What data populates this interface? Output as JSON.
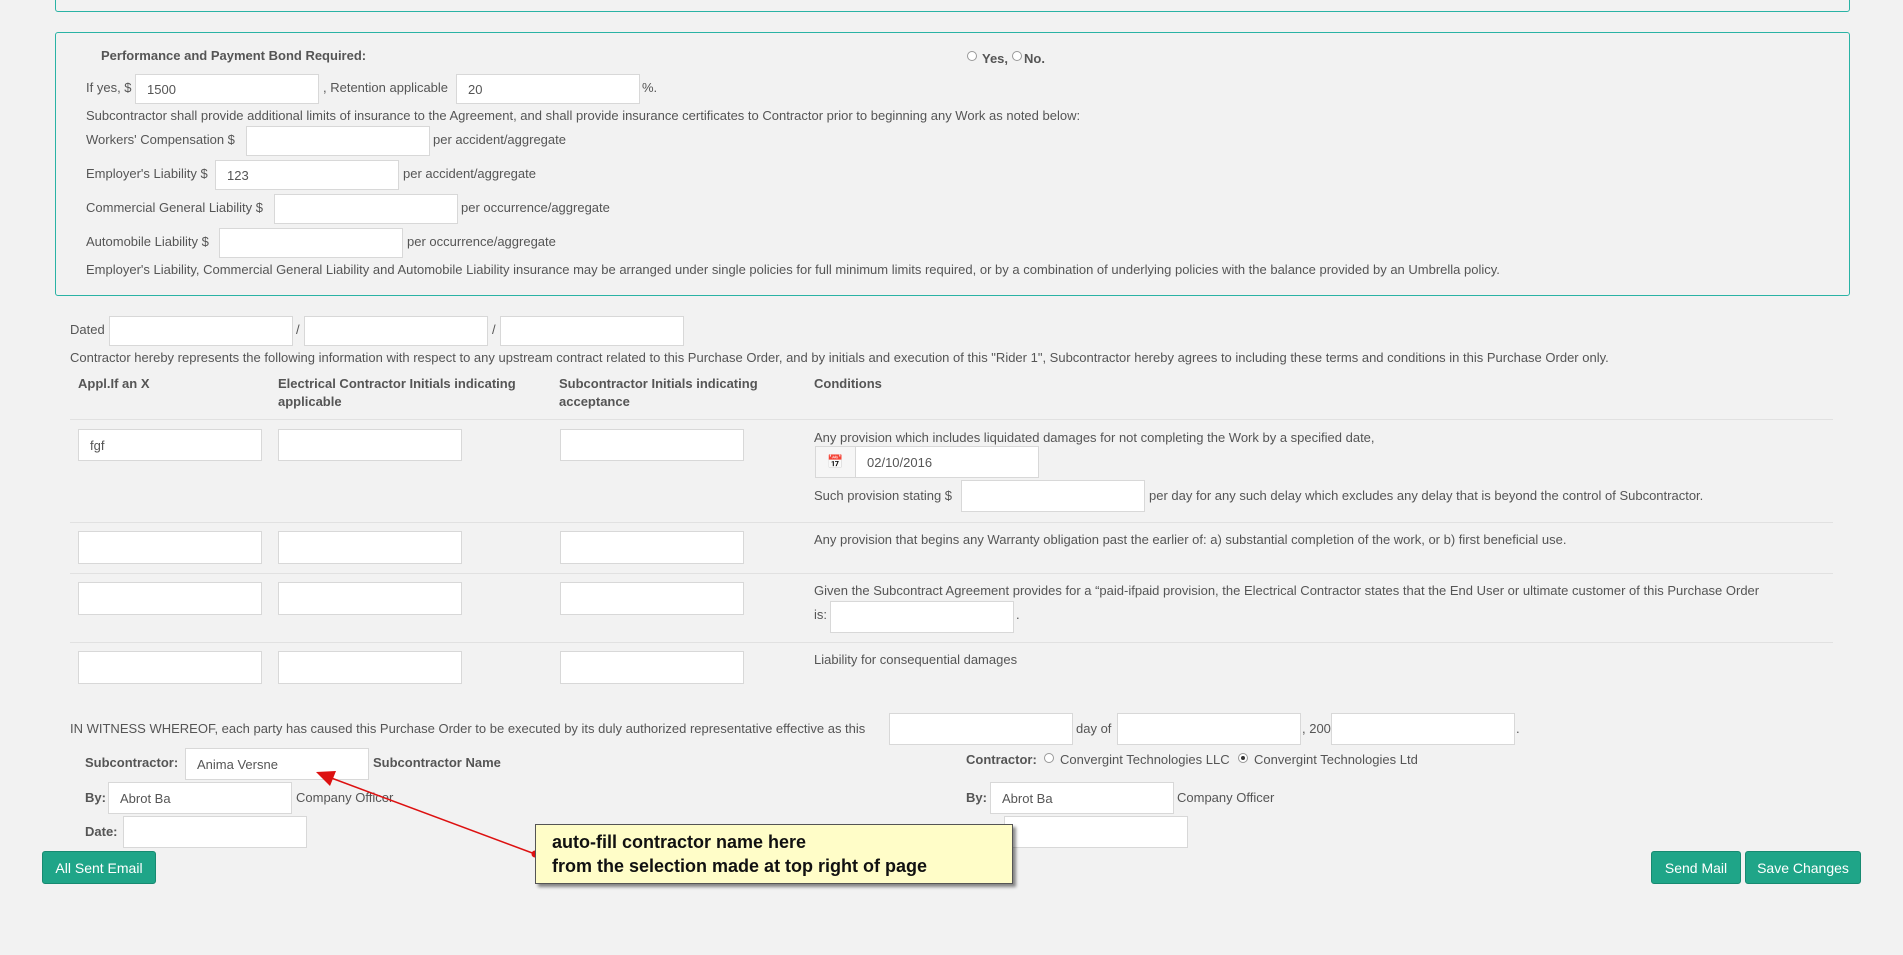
{
  "bond": {
    "heading": "Performance and Payment Bond Required:",
    "yes_label": "Yes,",
    "no_label": "No.",
    "if_yes_label": "If yes, $",
    "bond_amount": "1500",
    "retention_label": ", Retention applicable",
    "retention_value": "20",
    "percent_label": "%.",
    "insurance_intro": "Subcontractor shall provide additional limits of insurance to the Agreement, and shall provide insurance certificates to Contractor prior to beginning any Work as noted below:",
    "workers_comp_label": "Workers' Compensation $",
    "workers_comp_value": "",
    "workers_comp_suffix": "per accident/aggregate",
    "employers_label": "Employer's Liability $",
    "employers_value": "123",
    "employers_suffix": "per accident/aggregate",
    "cgl_label": "Commercial General Liability $",
    "cgl_value": "",
    "cgl_suffix": "per occurrence/aggregate",
    "auto_label": "Automobile Liability $",
    "auto_value": "",
    "auto_suffix": "per occurrence/aggregate",
    "umbrella_note": "Employer's Liability, Commercial General Liability and Automobile Liability insurance may be arranged under single policies for full minimum limits required, or by a combination of underlying policies with the balance provided by an Umbrella policy."
  },
  "rider": {
    "dated_label": "Dated",
    "slash": "/",
    "intro": "Contractor hereby represents the following information with respect to any upstream contract related to this Purchase Order, and by initials and execution of this \"Rider 1\", Subcontractor hereby agrees to including these terms and conditions in this Purchase Order only.",
    "col_appl": "Appl.If an X",
    "col_electrical_1": "Electrical Contractor Initials indicating",
    "col_electrical_2": "applicable",
    "col_subcontractor_1": "Subcontractor Initials indicating",
    "col_subcontractor_2": "acceptance",
    "col_conditions": "Conditions",
    "row1_appl": "fgf",
    "row1_condition": "Any provision which includes liquidated damages for not completing the Work by a specified date,",
    "row1_date": "02/10/2016",
    "row1_provision_label": "Such provision stating $",
    "row1_provision_suffix": "per day for any such delay which excludes any delay that is beyond the control of Subcontractor.",
    "row2_condition": "Any provision that begins any Warranty obligation past the earlier of: a) substantial completion of the work, or b) first beneficial use.",
    "row3_condition_1": "Given the Subcontract Agreement provides for a “paid-ifpaid provision, the Electrical Contractor states that the End User or ultimate customer of this Purchase Order",
    "row3_condition_2": "is:",
    "row3_period": ".",
    "row4_condition": "Liability for consequential damages"
  },
  "witness": {
    "text": "IN WITNESS WHEREOF, each party has caused this Purchase Order to be executed by its duly authorized representative effective as this",
    "day_of": "day of",
    "year_prefix": ", 200",
    "period": "."
  },
  "signatures": {
    "subcontractor_label": "Subcontractor:",
    "subcontractor_value": "Anima Versne",
    "subcontractor_name_label": "Subcontractor Name",
    "by_label": "By:",
    "sub_by_value": "Abrot Ba",
    "company_officer": "Company Officer",
    "date_label": "Date:",
    "contractor_label": "Contractor:",
    "contractor_option_1": "Convergint Technologies LLC",
    "contractor_option_2": "Convergint Technologies Ltd",
    "contractor_by_value": "Abrot Ba"
  },
  "buttons": {
    "all_sent_email": "All Sent Email",
    "send_mail": "Send Mail",
    "save_changes": "Save Changes"
  },
  "annotation": {
    "line1": "auto-fill contractor name here",
    "line2": "from the selection made at top right of page"
  },
  "colors": {
    "panel_border": "#2ab3a5",
    "button": "#1fa588",
    "annotation_bg": "#fffdc8",
    "arrow": "#d11"
  }
}
